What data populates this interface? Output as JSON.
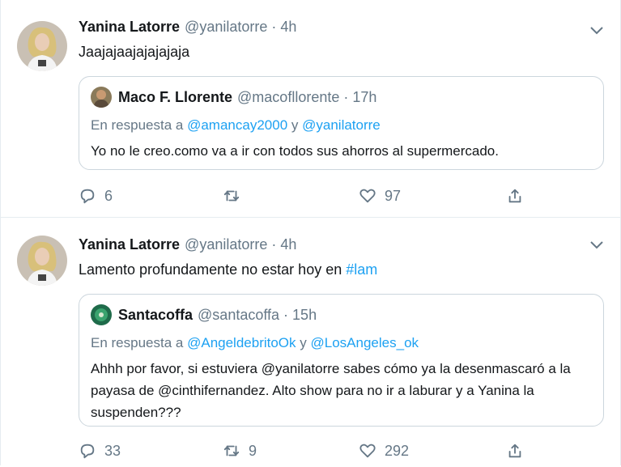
{
  "tweets": [
    {
      "author_name": "Yanina Latorre",
      "author_handle": "@yanilatorre",
      "separator": "·",
      "time": "4h",
      "text": "Jaajajaajajajajaja",
      "quote": {
        "author_name": "Maco F. Llorente",
        "author_handle": "@macofllorente",
        "separator": "·",
        "time": "17h",
        "reply_prefix": "En respuesta a",
        "reply_mention_1": "@amancay2000",
        "reply_conjunction": "y",
        "reply_mention_2": "@yanilatorre",
        "text": "Yo no le creo.como va a ir con todos sus ahorros al supermercado."
      },
      "replies": "6",
      "retweets": "",
      "likes": "97"
    },
    {
      "author_name": "Yanina Latorre",
      "author_handle": "@yanilatorre",
      "separator": "·",
      "time": "4h",
      "text_before": "Lamento profundamente no estar hoy en",
      "hashtag": "#lam",
      "quote": {
        "author_name": "Santacoffa",
        "author_handle": "@santacoffa",
        "separator": "·",
        "time": "15h",
        "reply_prefix": "En respuesta a",
        "reply_mention_1": "@AngeldebritoOk",
        "reply_conjunction": "y",
        "reply_mention_2": "@LosAngeles_ok",
        "text": "Ahhh por favor, si estuviera @yanilatorre sabes cómo ya la desenmascaró a la payasa de @cinthifernandez. Alto show para no ir a laburar y a Yanina la suspenden???"
      },
      "replies": "33",
      "retweets": "9",
      "likes": "292"
    }
  ],
  "colors": {
    "link": "#1da1f2",
    "muted": "#657786",
    "border": "#e6ecf0"
  },
  "icons": [
    "reply-icon",
    "retweet-icon",
    "like-icon",
    "share-icon",
    "chevron-down-icon"
  ]
}
